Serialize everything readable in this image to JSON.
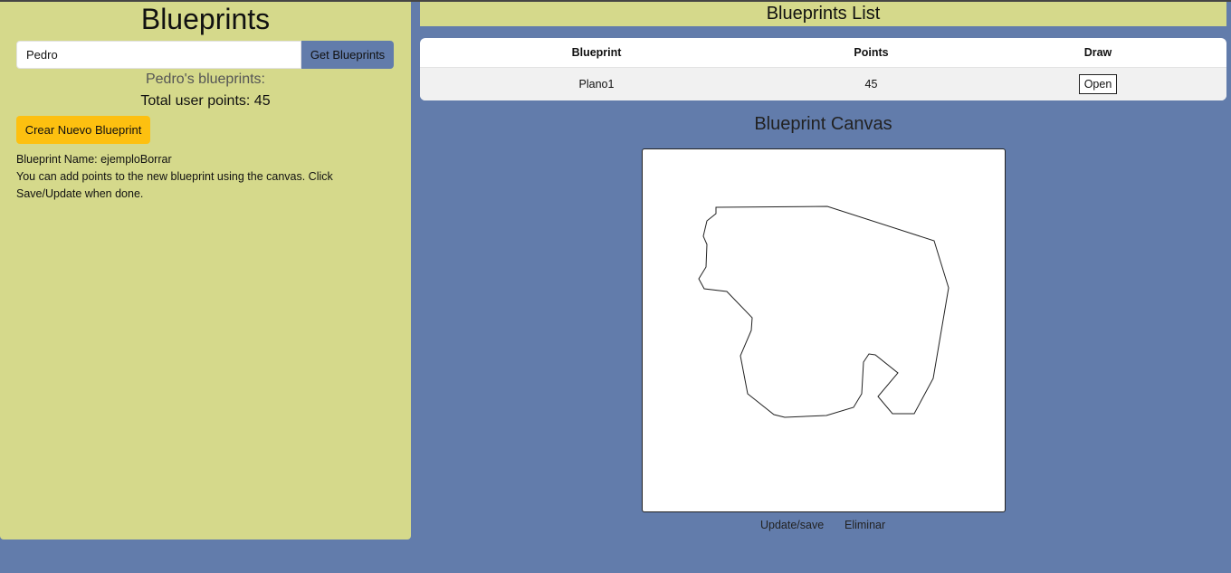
{
  "app": {
    "title": "Blueprints"
  },
  "search": {
    "author_value": "Pedro",
    "get_button_label": "Get Blueprints"
  },
  "author_info": {
    "heading": "Pedro's blueprints:",
    "total_points_text": "Total user points: 45"
  },
  "create": {
    "button_label": "Crear Nuevo Blueprint",
    "name_line": "Blueprint Name: ejemploBorrar",
    "instructions": "You can add points to the new blueprint using the canvas. Click Save/Update when done."
  },
  "list": {
    "title": "Blueprints List",
    "columns": [
      "Blueprint",
      "Points",
      "Draw"
    ],
    "rows": [
      {
        "name": "Plano1",
        "points": "45",
        "action_label": "Open"
      }
    ]
  },
  "canvas": {
    "title": "Blueprint Canvas",
    "update_label": "Update/save",
    "delete_label": "Eliminar"
  },
  "colors": {
    "page_background": "#627cab",
    "panel_background": "#d5d98b",
    "accent_button": "#627cab",
    "create_button": "#fdc010"
  }
}
